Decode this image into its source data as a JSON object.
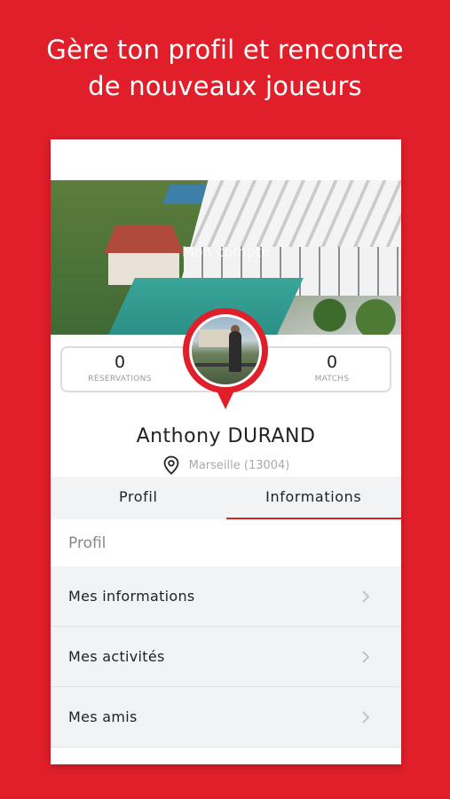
{
  "headline": {
    "line1": "Gère ton profil et rencontre",
    "line2": "de nouveaux joueurs"
  },
  "profile": {
    "header_title": "Mon compte",
    "reservations_count": "0",
    "reservations_label": "RÉSERVATIONS",
    "matchs_count": "0",
    "matchs_label": "MATCHS",
    "name": "Anthony DURAND",
    "location": "Marseille (13004)"
  },
  "tabs": [
    {
      "label": "Profil",
      "active": false
    },
    {
      "label": "Informations",
      "active": true
    }
  ],
  "section": {
    "title": "Profil"
  },
  "menu": [
    {
      "label": "Mes informations"
    },
    {
      "label": "Mes activités"
    },
    {
      "label": "Mes amis"
    }
  ],
  "colors": {
    "accent": "#e01f2b",
    "background": "#e01f2b",
    "list_bg": "#f2f3f5"
  }
}
